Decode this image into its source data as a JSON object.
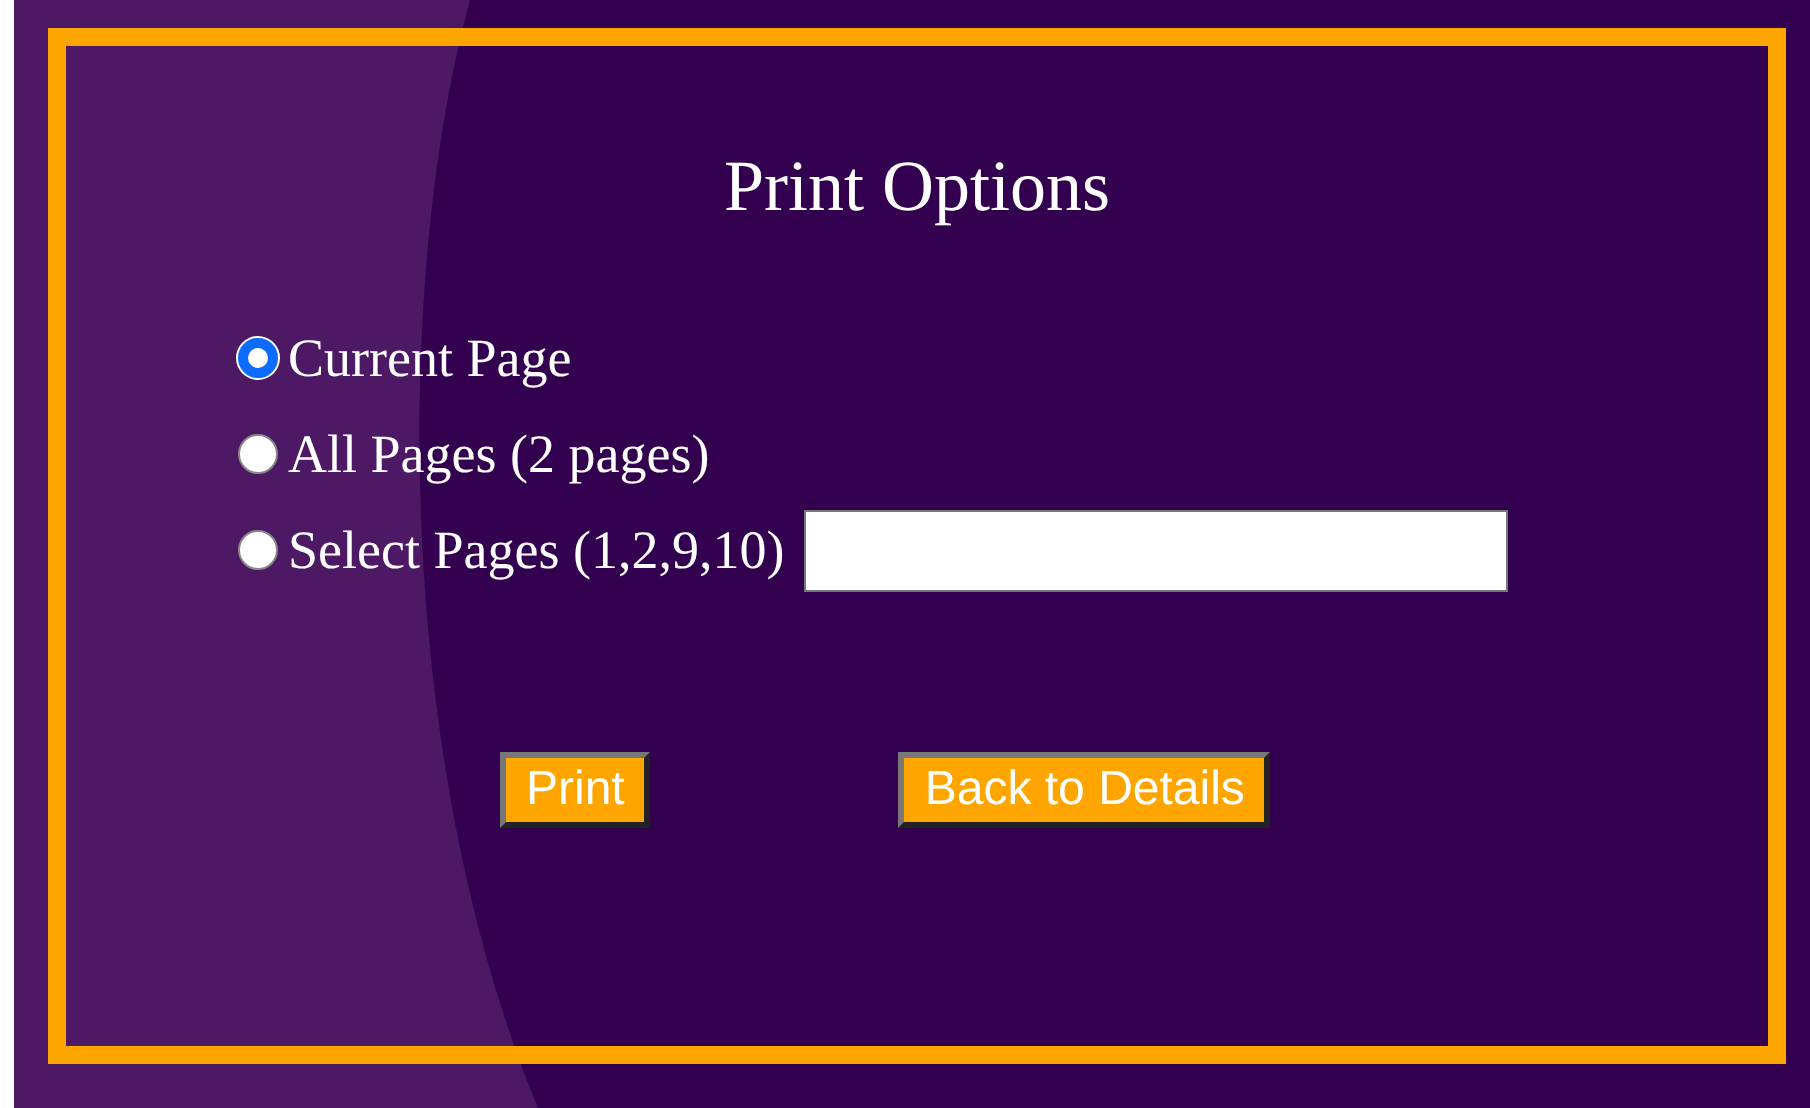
{
  "title": "Print Options",
  "options": [
    {
      "label": "Current Page",
      "selected": true,
      "kind": "plain"
    },
    {
      "label": "All Pages (2 pages)",
      "selected": false,
      "kind": "plain"
    },
    {
      "label": "Select Pages (1,2,9,10)",
      "selected": false,
      "kind": "field"
    }
  ],
  "buttons": [
    {
      "label": "Print"
    },
    {
      "label": "Back to Details"
    }
  ]
}
